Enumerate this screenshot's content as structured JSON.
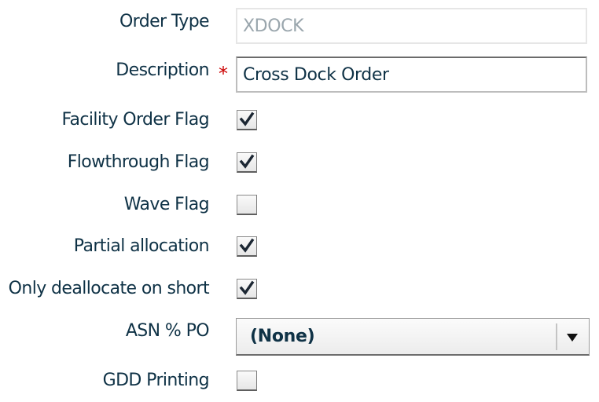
{
  "form": {
    "order_type": {
      "label": "Order Type",
      "value": "XDOCK",
      "readonly": true
    },
    "description": {
      "label": "Description",
      "required_marker": "*",
      "value": "Cross Dock Order"
    },
    "facility_order_flag": {
      "label": "Facility Order Flag",
      "checked": true
    },
    "flowthrough_flag": {
      "label": "Flowthrough Flag",
      "checked": true
    },
    "wave_flag": {
      "label": "Wave Flag",
      "checked": false
    },
    "partial_allocation": {
      "label": "Partial allocation",
      "checked": true
    },
    "only_deallocate_on_short": {
      "label": "Only deallocate on short",
      "checked": true
    },
    "asn_po": {
      "label": "ASN % PO",
      "selected": "(None)"
    },
    "gdd_printing": {
      "label": "GDD Printing",
      "checked": false
    }
  },
  "colors": {
    "text": "#0f3246",
    "required": "#cc0000",
    "readonly_text": "#9aa6ad"
  }
}
